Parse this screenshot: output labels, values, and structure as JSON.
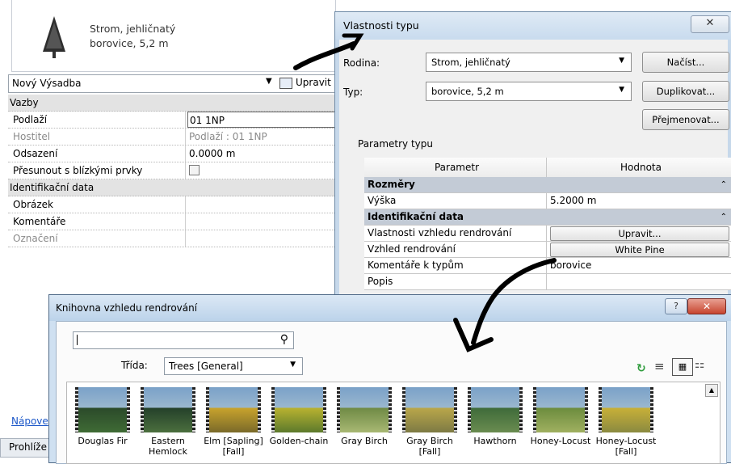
{
  "properties": {
    "type_name_line1": "Strom, jehličnatý",
    "type_name_line2": "borovice, 5,2 m",
    "instance_selector": "Nový Výsadba",
    "edit_type_label": "Upravit",
    "rows": [
      {
        "kind": "group",
        "label": "Vazby"
      },
      {
        "kind": "prop",
        "label": "Podlaží",
        "value": "01 1NP",
        "boxed": true
      },
      {
        "kind": "prop",
        "label": "Hostitel",
        "value": "Podlaží : 01 1NP",
        "dim": true
      },
      {
        "kind": "prop",
        "label": "Odsazení",
        "value": "0.0000 m"
      },
      {
        "kind": "check",
        "label": "Přesunout s blízkými prvky",
        "value": ""
      },
      {
        "kind": "group",
        "label": "Identifikační data"
      },
      {
        "kind": "prop",
        "label": "Obrázek",
        "value": ""
      },
      {
        "kind": "prop",
        "label": "Komentáře",
        "value": ""
      },
      {
        "kind": "prop",
        "label": "Označení",
        "value": "",
        "dim": true
      }
    ],
    "help_link": "Nápove",
    "browser_label": "Prohlíže"
  },
  "type_dialog": {
    "title": "Vlastnosti typu",
    "close_glyph": "✕",
    "family_label": "Rodina:",
    "family_value": "Strom, jehličnatý",
    "type_label": "Typ:",
    "type_value": "borovice, 5,2 m",
    "load_button": "Načíst...",
    "duplicate_button": "Duplikovat...",
    "rename_button": "Přejmenovat...",
    "params_label": "Parametry typu",
    "col_param": "Parametr",
    "col_value": "Hodnota",
    "rows": [
      {
        "kind": "group",
        "label": "Rozměry"
      },
      {
        "kind": "prop",
        "label": "Výška",
        "value": "5.2000 m"
      },
      {
        "kind": "group",
        "label": "Identifikační data"
      },
      {
        "kind": "btn",
        "label": "Vlastnosti vzhledu rendrování",
        "value": "Upravit..."
      },
      {
        "kind": "btn",
        "label": "Vzhled rendrování",
        "value": "White Pine"
      },
      {
        "kind": "prop",
        "label": "Komentáře k typům",
        "value": "borovice"
      },
      {
        "kind": "prop",
        "label": "Popis",
        "value": ""
      }
    ]
  },
  "library_dialog": {
    "title": "Knihovna vzhledu rendrování",
    "search_value": "",
    "class_label": "Třída:",
    "class_value": "Trees [General]",
    "items": [
      {
        "name": "Douglas Fir",
        "hint": "fir"
      },
      {
        "name": "Eastern Hemlock",
        "hint": "hemlock"
      },
      {
        "name": "Elm [Sapling] [Fall]",
        "hint": "elm_fall"
      },
      {
        "name": "Golden-chain",
        "hint": "golden"
      },
      {
        "name": "Gray Birch",
        "hint": "birch"
      },
      {
        "name": "Gray Birch [Fall]",
        "hint": "birch_fall"
      },
      {
        "name": "Hawthorn",
        "hint": "hawthorn"
      },
      {
        "name": "Honey-Locust",
        "hint": "locust"
      },
      {
        "name": "Honey-Locust [Fall]",
        "hint": "locust_fall"
      }
    ]
  },
  "colors": {
    "group_row": "#e3e3e3",
    "param_group": "#c3cbd6",
    "dialog_frame": "#c6d8ea",
    "close_red": "#c7452f",
    "link": "#1a56c8"
  }
}
